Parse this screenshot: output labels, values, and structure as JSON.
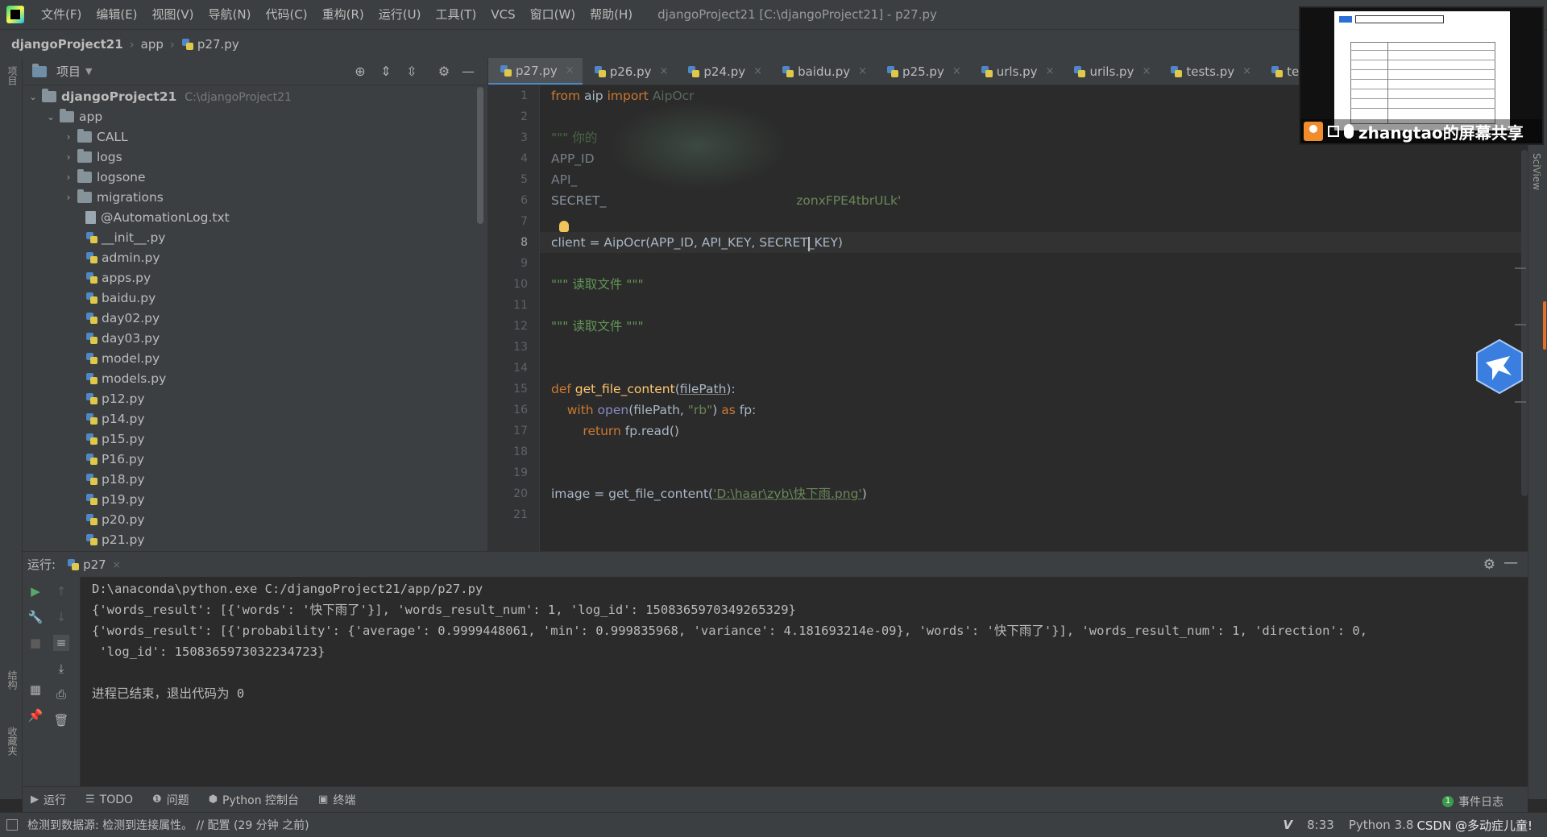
{
  "menu": {
    "items": [
      "文件(F)",
      "编辑(E)",
      "视图(V)",
      "导航(N)",
      "代码(C)",
      "重构(R)",
      "运行(U)",
      "工具(T)",
      "VCS",
      "窗口(W)",
      "帮助(H)"
    ],
    "window_title": "djangoProject21 [C:\\djangoProject21] - p27.py"
  },
  "breadcrumb": [
    "djangoProject21",
    "app",
    "p27.py"
  ],
  "left_strip": {
    "project_label": "项目",
    "structure_label": "结构",
    "favorites_label": "收藏夹"
  },
  "project_panel": {
    "title": "项目",
    "root": {
      "name": "djangoProject21",
      "path": "C:\\djangoProject21"
    },
    "app_folder": "app",
    "folders": [
      "CALL",
      "logs",
      "logsone",
      "migrations"
    ],
    "files": [
      "@AutomationLog.txt",
      "__init__.py",
      "admin.py",
      "apps.py",
      "baidu.py",
      "day02.py",
      "day03.py",
      "model.py",
      "models.py",
      "p12.py",
      "p14.py",
      "p15.py",
      "P16.py",
      "p18.py",
      "p19.py",
      "p20.py",
      "p21.py"
    ]
  },
  "editor_tabs": [
    "p27.py",
    "p26.py",
    "p24.py",
    "baidu.py",
    "p25.py",
    "urls.py",
    "urils.py",
    "tests.py",
    "ten.py"
  ],
  "editor": {
    "line_numbers": [
      "1",
      "2",
      "3",
      "4",
      "5",
      "6",
      "7",
      "8",
      "9",
      "10",
      "11",
      "12",
      "13",
      "14",
      "15",
      "16",
      "17",
      "18",
      "19",
      "20",
      "21"
    ],
    "current_line": "8",
    "lines": {
      "l1_kw1": "from",
      "l1_mod": " aip ",
      "l1_kw2": "import",
      "l1_name": " AipOcr",
      "l3": "\"\"\" 你的",
      "l4": "APP_ID",
      "l5": "API_",
      "l6_name": "SECRET_",
      "l6_str": "zonxFPE4tbrULk'",
      "l8_a": "client = AipOcr(APP_ID, API_KEY,",
      "l8_b": " SECRET_KEY)",
      "l10": "\"\"\" 读取文件 \"\"\"",
      "l12": "\"\"\" 读取文件 \"\"\"",
      "l15_kw": "def",
      "l15_fn": "get_file_content",
      "l15_open": "(",
      "l15_param": "filePath",
      "l15_close": "):",
      "l16_kw": "with",
      "l16_open": " open",
      "l16_args": "(filePath, ",
      "l16_str": "\"rb\"",
      "l16_close": ") ",
      "l16_as": "as",
      "l16_fp": " fp:",
      "l17_kw": "return",
      "l17_rest": " fp.read()",
      "l20_a": "image = get_file_content(",
      "l20_str": "'D:\\haar\\zyb\\快下雨.png'",
      "l20_b": ")"
    }
  },
  "run_panel": {
    "label": "运行:",
    "tab": "p27",
    "console": [
      "D:\\anaconda\\python.exe C:/djangoProject21/app/p27.py",
      "{'words_result': [{'words': '快下雨了'}], 'words_result_num': 1, 'log_id': 1508365970349265329}",
      "{'words_result': [{'probability': {'average': 0.9999448061, 'min': 0.999835968, 'variance': 4.181693214e-09}, 'words': '快下雨了'}], 'words_result_num': 1, 'direction': 0,",
      " 'log_id': 1508365973032234723}",
      "",
      "进程已结束，退出代码为 0"
    ]
  },
  "tool_tabs": [
    {
      "icon": "▶",
      "label": "运行"
    },
    {
      "icon": "☰",
      "label": "TODO"
    },
    {
      "icon": "❶",
      "label": "问题"
    },
    {
      "icon": "⬢",
      "label": "Python 控制台"
    },
    {
      "icon": "▣",
      "label": "终端"
    }
  ],
  "event_log": {
    "count": "1",
    "label": "事件日志"
  },
  "status": {
    "message": "检测到数据源: 检测到连接属性。 // 配置 (29 分钟 之前)",
    "v_icon": "V",
    "position": "8:33",
    "interpreter": "Python 3.8",
    "watermark": "CSDN @多动症儿童!"
  },
  "right_strip": {
    "sciview_label": "SciView"
  },
  "screen_share": {
    "label": "zhangtao的屏幕共享"
  },
  "colors": {
    "accent": "#4a88c7",
    "keyword": "#cc7832",
    "function": "#ffc66d",
    "string": "#6a8759",
    "background": "#2b2b2b",
    "panel": "#3c3f41"
  }
}
